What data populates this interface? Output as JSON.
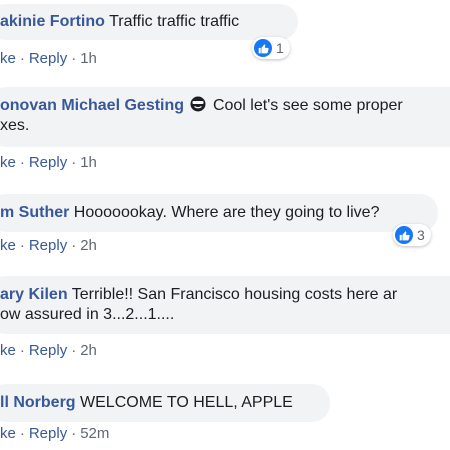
{
  "colors": {
    "author": "#385898",
    "bubble": "#f2f3f5",
    "text": "#1c1e21",
    "meta": "#606770",
    "like": "#1877f2"
  },
  "comments": [
    {
      "author": "akinie Fortino",
      "text": "Traffic traffic traffic",
      "like": "ke",
      "reply": "Reply",
      "time": "1h",
      "reactions": "1",
      "reaction_icon": "like-icon"
    },
    {
      "author": "onovan Michael Gesting",
      "emoji": "sunglasses-emoji-icon",
      "text": "Cool let's see some proper",
      "text2": "xes.",
      "like": "ke",
      "reply": "Reply",
      "time": "1h"
    },
    {
      "author": "m Suther",
      "text": "Hooooookay. Where are they going to live?",
      "like": "ke",
      "reply": "Reply",
      "time": "2h",
      "reactions": "3",
      "reaction_icon": "like-icon"
    },
    {
      "author": "ary Kilen",
      "text": "Terrible!! San Francisco housing costs here ar",
      "text2": "ow assured in 3...2...1....",
      "like": "ke",
      "reply": "Reply",
      "time": "2h"
    },
    {
      "author": "ll Norberg",
      "text": "WELCOME TO HELL, APPLE",
      "like": "ke",
      "reply": "Reply",
      "time": "52m"
    }
  ]
}
